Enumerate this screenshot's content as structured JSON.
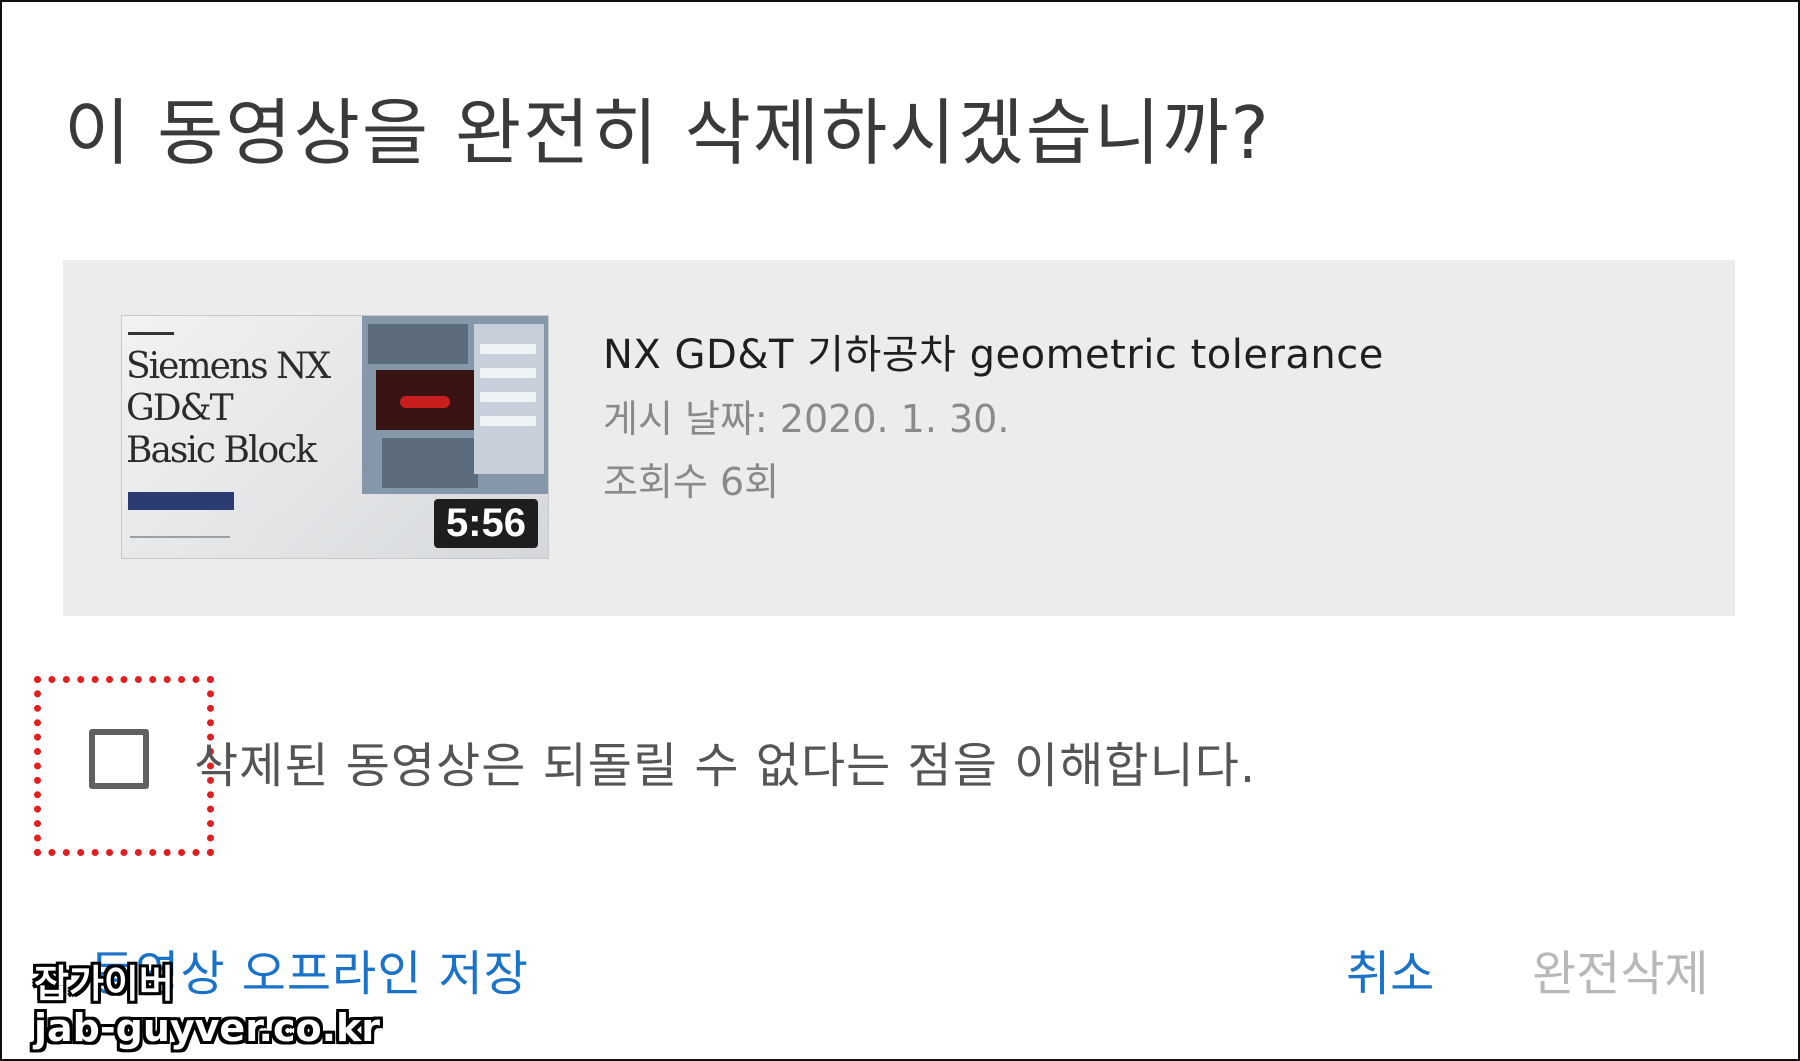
{
  "dialog": {
    "title": "이 동영상을 완전히 삭제하시겠습니까?"
  },
  "video": {
    "thumbnail_title": "Siemens NX\nGD&T\nBasic Block",
    "duration": "5:56",
    "title": "NX GD&T 기하공차 geometric tolerance",
    "posted_date": "게시 날짜: 2020. 1. 30.",
    "views": "조회수 6회"
  },
  "confirm": {
    "checked": false,
    "label": "삭제된 동영상은 되돌릴 수 없다는 점을 이해합니다."
  },
  "actions": {
    "save_offline": "동영상 오프라인 저장",
    "cancel": "취소",
    "delete": "완전삭제"
  },
  "watermark": {
    "name": "잡가이버",
    "url": "jab-guyver.co.kr"
  },
  "colors": {
    "link_blue": "#1a73c8",
    "disabled_gray": "#b8b8b8",
    "highlight_red": "#e02020",
    "card_background": "#ececec"
  }
}
